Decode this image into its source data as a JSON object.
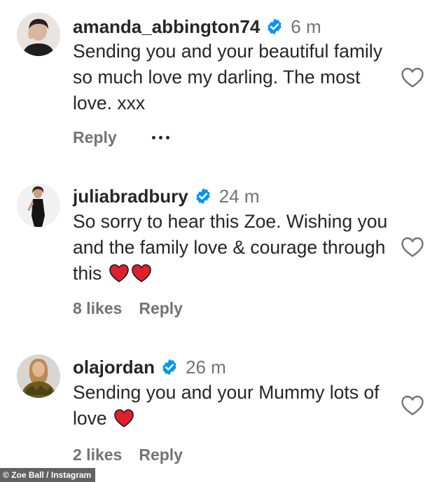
{
  "comments": [
    {
      "username": "amanda_abbington74",
      "time": "6 m",
      "text": "Sending you and your beautiful family so much love my darling. The most love. xxx",
      "reply_label": "Reply"
    },
    {
      "username": "juliabradbury",
      "time": "24 m",
      "text": "So sorry to hear this Zoe. Wishing you and the family love & courage through this",
      "emoji": [
        "red-heart",
        "red-heart"
      ],
      "likes": "8 likes",
      "reply_label": "Reply"
    },
    {
      "username": "olajordan",
      "time": "26 m",
      "text": "Sending you and your Mummy lots of love",
      "emoji": [
        "red-heart"
      ],
      "likes": "2 likes",
      "reply_label": "Reply"
    }
  ],
  "icons": {
    "verified": "verified-badge-icon",
    "like": "heart-outline-icon",
    "more": "more-options-icon"
  },
  "colors": {
    "verified_blue": "#0095f6",
    "text_primary": "#262626",
    "text_secondary": "#737373",
    "heart_red": "#e0202d"
  },
  "credit": "© Zoe Ball / Instagram"
}
